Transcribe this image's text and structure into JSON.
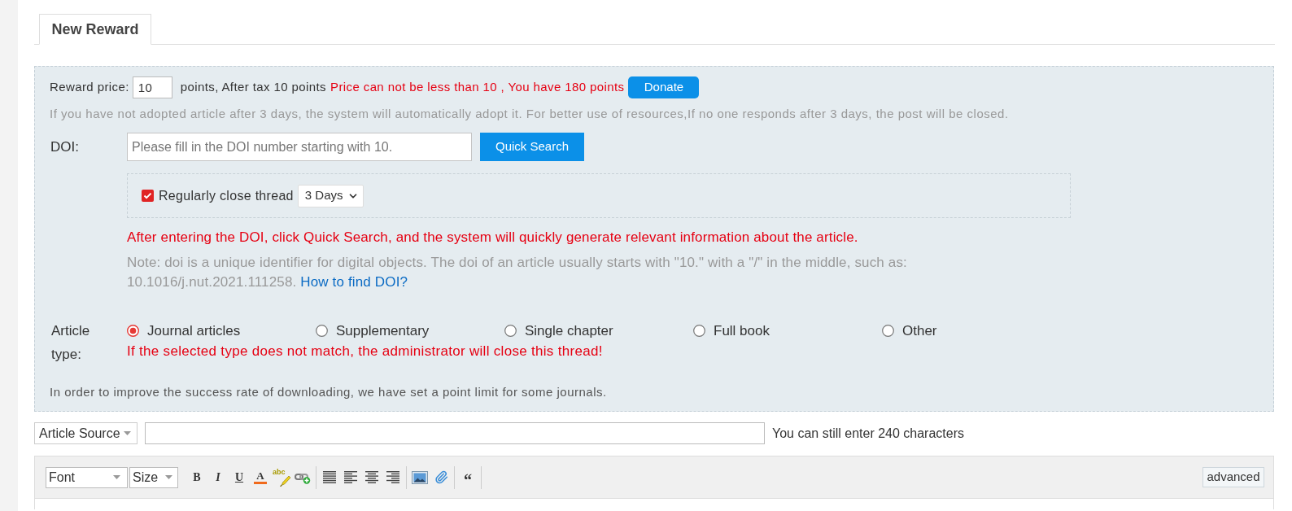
{
  "tabs": [
    {
      "label": "New Reward",
      "selected": true
    }
  ],
  "reward": {
    "label": "Reward price:",
    "value": "10",
    "after_tax": "points, After tax 10 points",
    "warning": "Price can not be less than 10 , You have 180 points",
    "button": "Donate"
  },
  "notice": "If you have not adopted article after 3 days, the system will automatically adopt it. For better use of resources,If no one responds after 3 days, the post will be closed.",
  "doi": {
    "label": "DOI:",
    "placeholder": "Please fill in the DOI number starting with 10.",
    "button": "Quick Search"
  },
  "close_thread": {
    "label": "Regularly close thread",
    "checked": true,
    "period": "3 Days"
  },
  "doi_hint": "After entering the DOI, click Quick Search, and the system will quickly generate relevant information about the article.",
  "doi_note": {
    "text": "Note: doi is a unique identifier for digital objects. The doi of an article usually starts with \"10.\" with a \"/\" in the middle, such as: 10.1016/j.nut.2021.111258.",
    "link": "How to find DOI?"
  },
  "article_type": {
    "label": "Article type:",
    "options": [
      {
        "label": "Journal articles",
        "selected": true
      },
      {
        "label": "Supplementary",
        "selected": false
      },
      {
        "label": "Single chapter",
        "selected": false
      },
      {
        "label": "Full book",
        "selected": false
      },
      {
        "label": "Other",
        "selected": false
      }
    ],
    "warning": "If the selected type does not match, the administrator will close this thread!"
  },
  "point_limit_note": "In order to improve the success rate of downloading, we have set a point limit for some journals.",
  "source": {
    "select": "Article Source",
    "counter": "You can still enter 240 characters"
  },
  "editor": {
    "font": "Font",
    "size": "Size",
    "bold": "B",
    "italic": "I",
    "underline": "U",
    "font_color": "A",
    "highlight": "abc",
    "quote": "“",
    "advanced": "advanced"
  }
}
